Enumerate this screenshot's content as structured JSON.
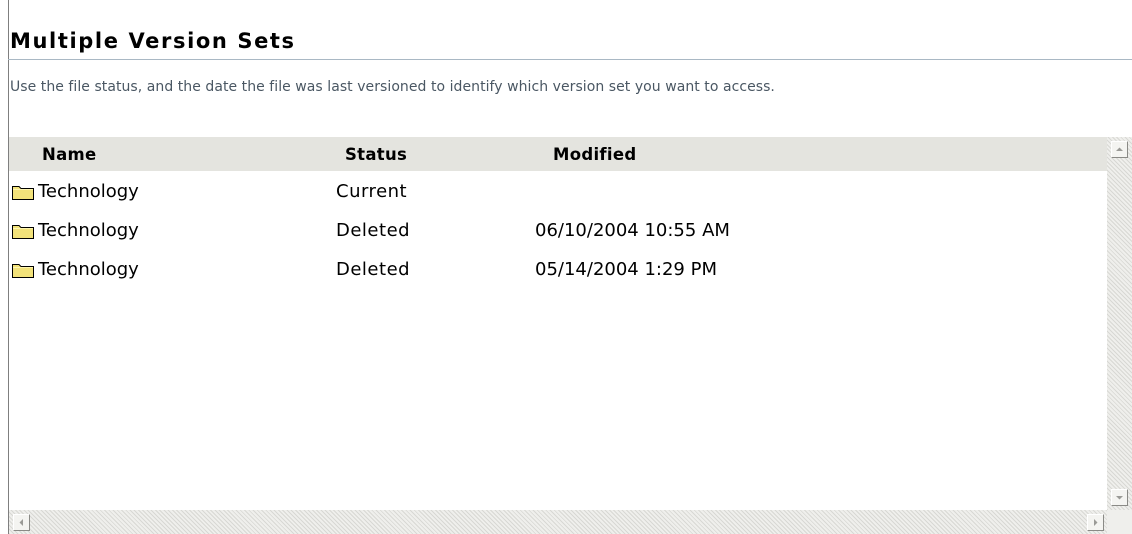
{
  "page": {
    "title": "Multiple Version Sets",
    "description": "Use the file status, and the date the file was last versioned to identify which version set you want to access."
  },
  "table": {
    "columns": {
      "name": "Name",
      "status": "Status",
      "modified": "Modified"
    },
    "rows": [
      {
        "icon": "folder-icon",
        "name": "Technology",
        "status": "Current",
        "modified": ""
      },
      {
        "icon": "folder-icon",
        "name": "Technology",
        "status": "Deleted",
        "modified": "06/10/2004 10:55 AM"
      },
      {
        "icon": "folder-icon",
        "name": "Technology",
        "status": "Deleted",
        "modified": "05/14/2004 1:29 PM"
      }
    ]
  },
  "scrollbars": {
    "vertical": {
      "up_icon": "arrow-up-icon",
      "down_icon": "arrow-down-icon"
    },
    "horizontal": {
      "left_icon": "arrow-left-icon",
      "right_icon": "arrow-right-icon"
    }
  },
  "colors": {
    "header_background": "#e4e4df",
    "description_text": "#4a5763",
    "folder_fill": "#f2e27a",
    "title_rule": "#a9b8c4"
  }
}
